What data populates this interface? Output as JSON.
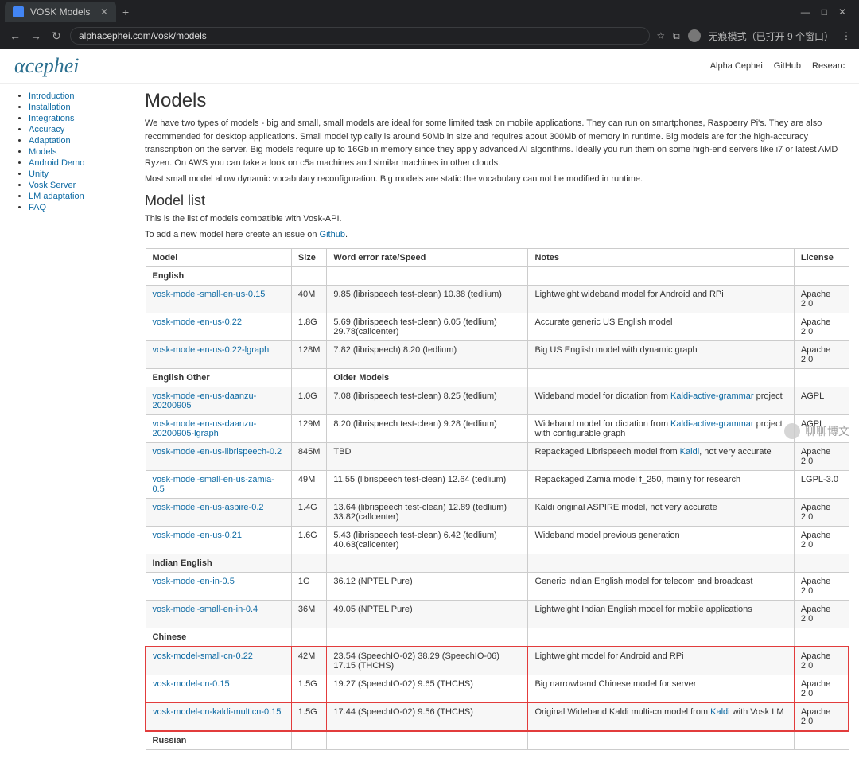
{
  "browser": {
    "tab_title": "VOSK Models",
    "url": "alphacephei.com/vosk/models",
    "incognito": "无痕模式（已打开 9 个窗口）",
    "win_min": "—",
    "win_max": "□",
    "win_close": "✕",
    "back": "←",
    "forward": "→",
    "reload": "↻",
    "star": "☆",
    "ext": "⧉",
    "menu": "⋮"
  },
  "header": {
    "logo": "αcephei",
    "links": [
      "Alpha Cephei",
      "GitHub",
      "Researc"
    ]
  },
  "sidebar": {
    "items": [
      "Introduction",
      "Installation",
      "Integrations",
      "Accuracy",
      "Adaptation",
      "Models",
      "Android Demo",
      "Unity",
      "Vosk Server",
      "LM adaptation",
      "FAQ"
    ]
  },
  "content": {
    "h1": "Models",
    "p1": "We have two types of models - big and small, small models are ideal for some limited task on mobile applications. They can run on smartphones, Raspberry Pi's. They are also recommended for desktop applications. Small model typically is around 50Mb in size and requires about 300Mb of memory in runtime. Big models are for the high-accuracy transcription on the server. Big models require up to 16Gb in memory since they apply advanced AI algorithms. Ideally you run them on some high-end servers like i7 or latest AMD Ryzen. On AWS you can take a look on c5a machines and similar machines in other clouds.",
    "p2": "Most small model allow dynamic vocabulary reconfiguration. Big models are static the vocabulary can not be modified in runtime.",
    "h2": "Model list",
    "p3": "This is the list of models compatible with Vosk-API.",
    "p4_pre": "To add a new model here create an issue on ",
    "p4_link": "Github"
  },
  "table": {
    "headers": [
      "Model",
      "Size",
      "Word error rate/Speed",
      "Notes",
      "License"
    ],
    "rows": [
      {
        "type": "section",
        "label": "English"
      },
      {
        "type": "row",
        "model": "vosk-model-small-en-us-0.15",
        "size": "40M",
        "wer": "9.85 (librispeech test-clean) 10.38 (tedlium)",
        "notes": "Lightweight wideband model for Android and RPi",
        "license": "Apache 2.0"
      },
      {
        "type": "row",
        "model": "vosk-model-en-us-0.22",
        "size": "1.8G",
        "wer": "5.69 (librispeech test-clean) 6.05 (tedlium) 29.78(callcenter)",
        "notes": "Accurate generic US English model",
        "license": "Apache 2.0"
      },
      {
        "type": "row",
        "model": "vosk-model-en-us-0.22-lgraph",
        "size": "128M",
        "wer": "7.82 (librispeech) 8.20 (tedlium)",
        "notes": "Big US English model with dynamic graph",
        "license": "Apache 2.0"
      },
      {
        "type": "section",
        "label": "English Other",
        "extra": "Older Models"
      },
      {
        "type": "row",
        "model": "vosk-model-en-us-daanzu-20200905",
        "size": "1.0G",
        "wer": "7.08 (librispeech test-clean) 8.25 (tedlium)",
        "notes_pre": "Wideband model for dictation from ",
        "notes_link": "Kaldi-active-grammar",
        "notes_post": " project",
        "license": "AGPL"
      },
      {
        "type": "row",
        "model": "vosk-model-en-us-daanzu-20200905-lgraph",
        "size": "129M",
        "wer": "8.20 (librispeech test-clean) 9.28 (tedlium)",
        "notes_pre": "Wideband model for dictation from ",
        "notes_link": "Kaldi-active-grammar",
        "notes_post": " project with configurable graph",
        "license": "AGPL"
      },
      {
        "type": "row",
        "model": "vosk-model-en-us-librispeech-0.2",
        "size": "845M",
        "wer": "TBD",
        "notes_pre": "Repackaged Librispeech model from ",
        "notes_link": "Kaldi",
        "notes_post": ", not very accurate",
        "license": "Apache 2.0"
      },
      {
        "type": "row",
        "model": "vosk-model-small-en-us-zamia-0.5",
        "size": "49M",
        "wer": "11.55 (librispeech test-clean) 12.64 (tedlium)",
        "notes": "Repackaged Zamia model f_250, mainly for research",
        "license": "LGPL-3.0"
      },
      {
        "type": "row",
        "model": "vosk-model-en-us-aspire-0.2",
        "size": "1.4G",
        "wer": "13.64 (librispeech test-clean) 12.89 (tedlium) 33.82(callcenter)",
        "notes": "Kaldi original ASPIRE model, not very accurate",
        "license": "Apache 2.0"
      },
      {
        "type": "row",
        "model": "vosk-model-en-us-0.21",
        "size": "1.6G",
        "wer": "5.43 (librispeech test-clean) 6.42 (tedlium) 40.63(callcenter)",
        "notes": "Wideband model previous generation",
        "license": "Apache 2.0"
      },
      {
        "type": "section",
        "label": "Indian English"
      },
      {
        "type": "row",
        "model": "vosk-model-en-in-0.5",
        "size": "1G",
        "wer": "36.12 (NPTEL Pure)",
        "notes": "Generic Indian English model for telecom and broadcast",
        "license": "Apache 2.0"
      },
      {
        "type": "row",
        "model": "vosk-model-small-en-in-0.4",
        "size": "36M",
        "wer": "49.05 (NPTEL Pure)",
        "notes": "Lightweight Indian English model for mobile applications",
        "license": "Apache 2.0"
      },
      {
        "type": "section",
        "label": "Chinese"
      },
      {
        "type": "row",
        "hi": "first",
        "model": "vosk-model-small-cn-0.22",
        "size": "42M",
        "wer": "23.54 (SpeechIO-02) 38.29 (SpeechIO-06) 17.15 (THCHS)",
        "notes": "Lightweight model for Android and RPi",
        "license": "Apache 2.0"
      },
      {
        "type": "row",
        "hi": "mid",
        "model": "vosk-model-cn-0.15",
        "size": "1.5G",
        "wer": "19.27 (SpeechIO-02) 9.65 (THCHS)",
        "notes": "Big narrowband Chinese model for server",
        "license": "Apache 2.0"
      },
      {
        "type": "row",
        "hi": "last",
        "model": "vosk-model-cn-kaldi-multicn-0.15",
        "size": "1.5G",
        "wer": "17.44 (SpeechIO-02) 9.56 (THCHS)",
        "notes_pre": "Original Wideband Kaldi multi-cn model from ",
        "notes_link": "Kaldi",
        "notes_post": " with Vosk LM",
        "license": "Apache 2.0"
      },
      {
        "type": "section",
        "label": "Russian"
      }
    ]
  },
  "watermark": "聊聊博文"
}
